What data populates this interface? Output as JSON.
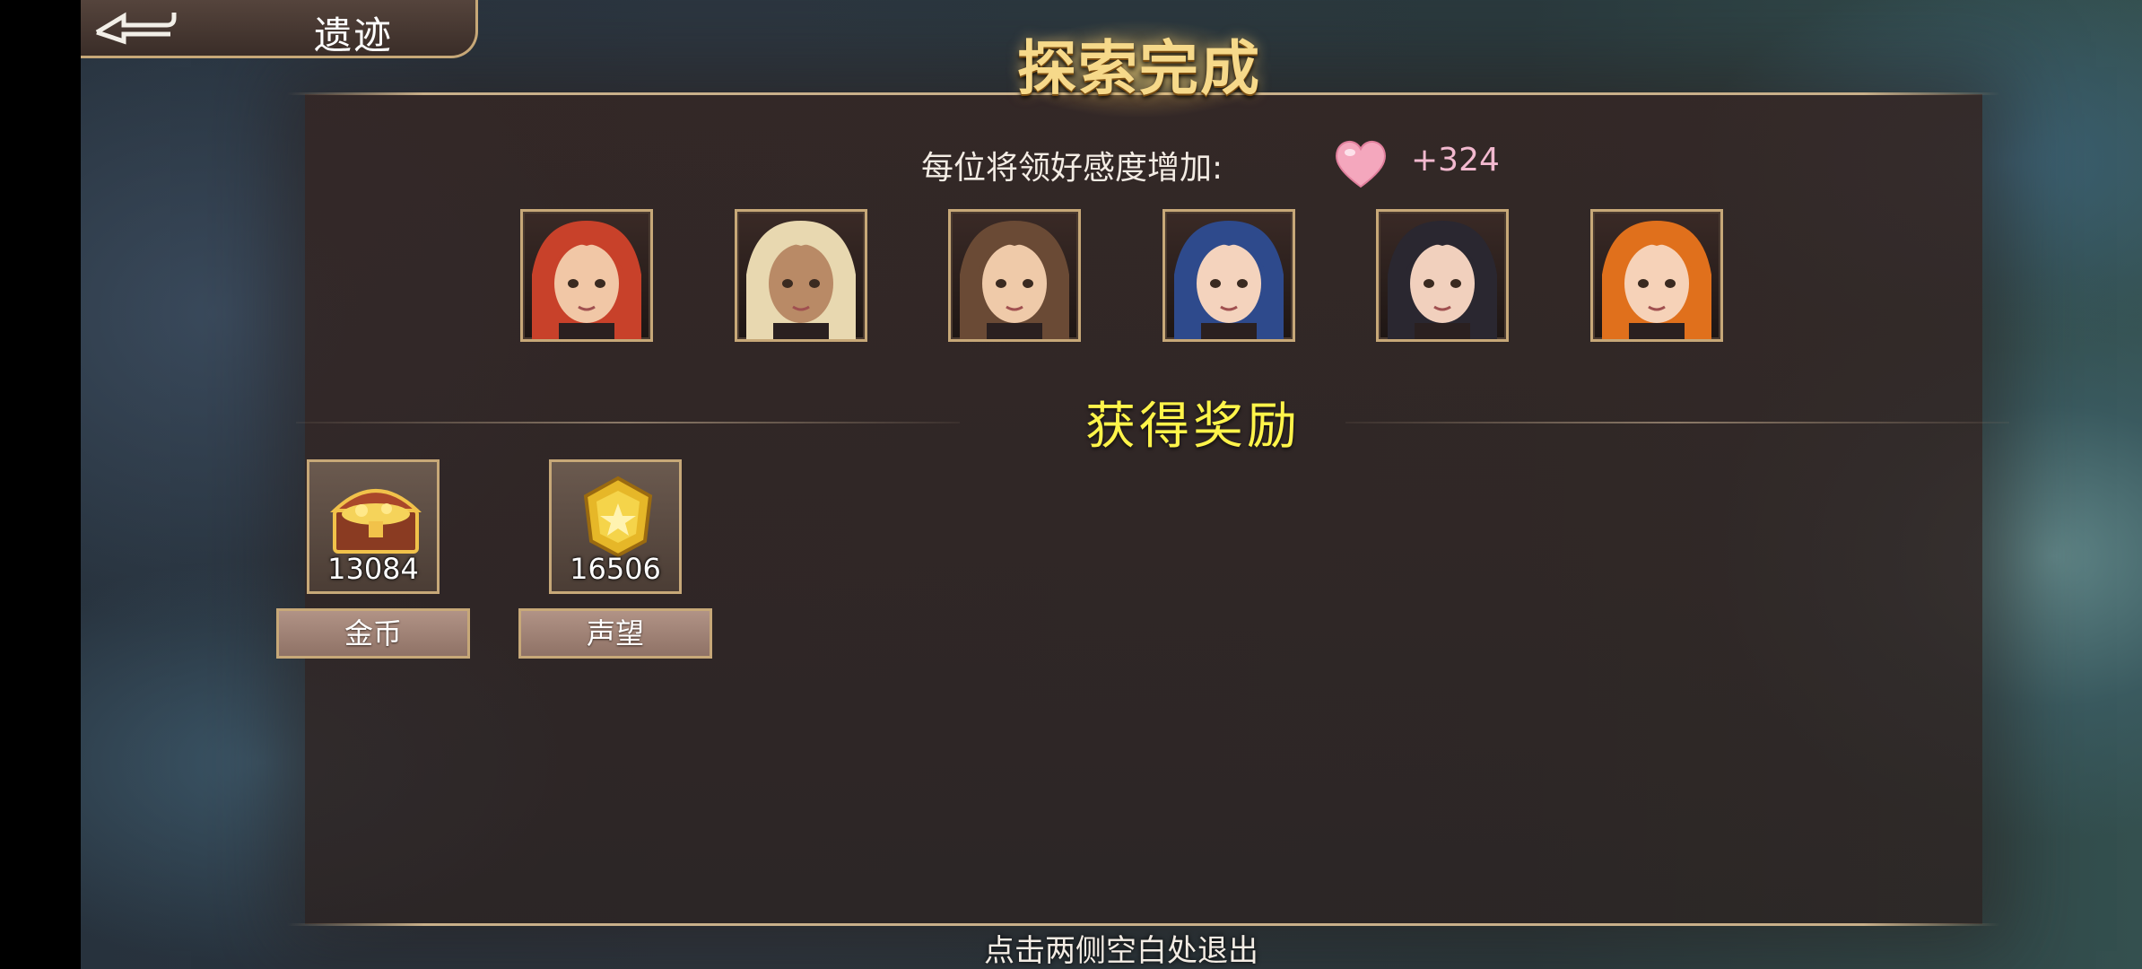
{
  "header": {
    "title": "遗迹"
  },
  "banner": {
    "title": "探索完成"
  },
  "affinity": {
    "label": "每位将领好感度增加:",
    "value": "+324",
    "icon": "heart-icon"
  },
  "heroes": [
    {
      "name": "hero-portrait-1",
      "hair": "#c8412a",
      "skin": "#f1c7a6"
    },
    {
      "name": "hero-portrait-2",
      "hair": "#e8d8b0",
      "skin": "#b98a66"
    },
    {
      "name": "hero-portrait-3",
      "hair": "#6a4a35",
      "skin": "#efcaa9"
    },
    {
      "name": "hero-portrait-4",
      "hair": "#2e4a8c",
      "skin": "#f4d3bd"
    },
    {
      "name": "hero-portrait-5",
      "hair": "#2a2730",
      "skin": "#f1d0bd"
    },
    {
      "name": "hero-portrait-6",
      "hair": "#e0701c",
      "skin": "#f6d2b8"
    }
  ],
  "rewards_section": {
    "title": "获得奖励"
  },
  "rewards": [
    {
      "label": "金币",
      "amount": "13084",
      "icon": "treasure-chest-icon"
    },
    {
      "label": "声望",
      "amount": "16506",
      "icon": "gold-badge-icon"
    }
  ],
  "footer": {
    "hint": "点击两侧空白处退出"
  },
  "colors": {
    "accent_gold": "#c7a878",
    "reward_title": "#fff44a",
    "affinity_value": "#f2b9cf"
  }
}
